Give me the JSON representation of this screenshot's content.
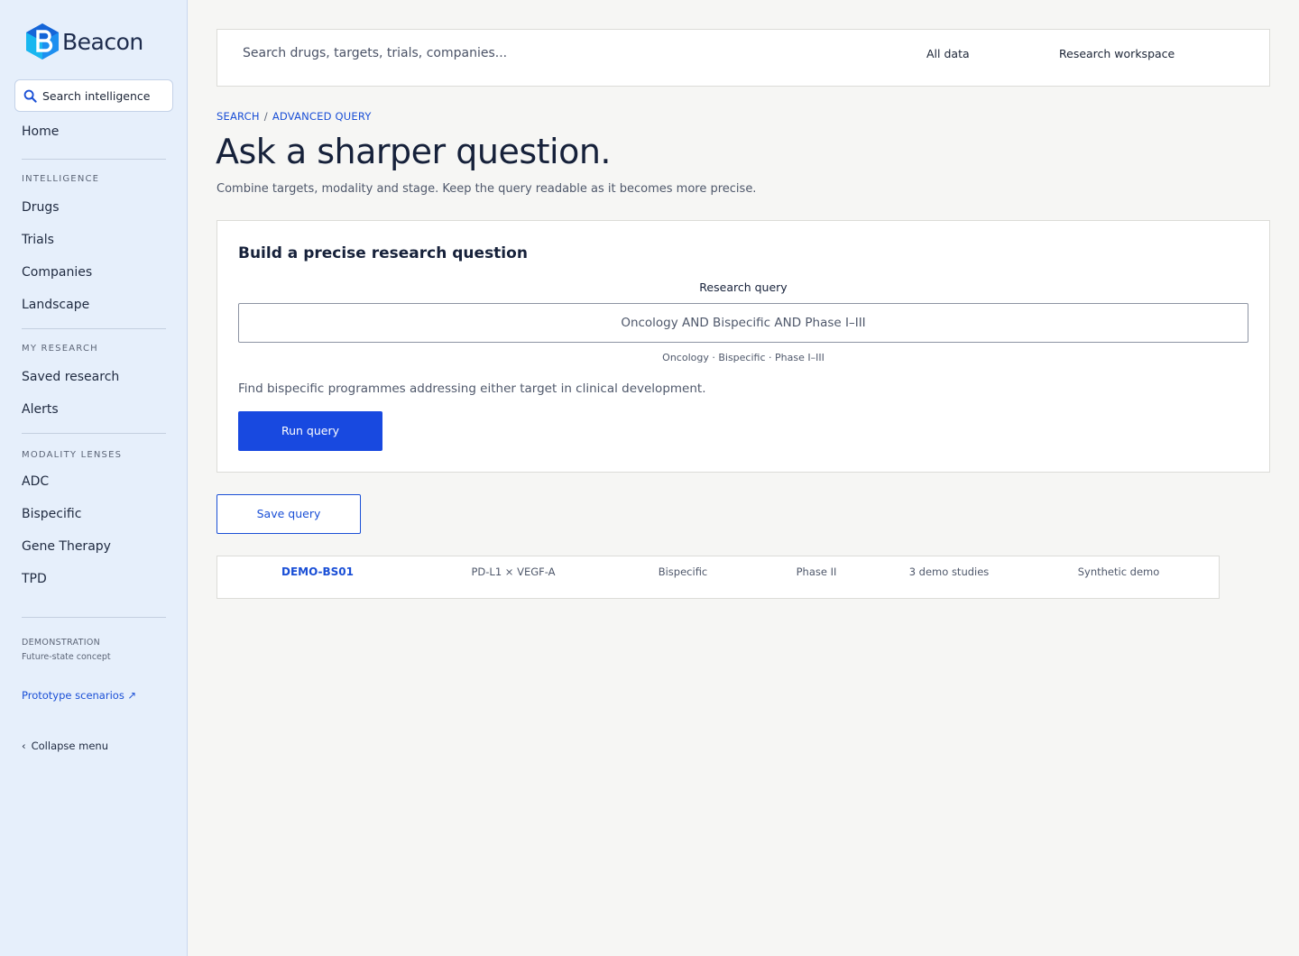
{
  "brand": {
    "name": "Beacon",
    "accent": "#1849e0"
  },
  "sidebar": {
    "search_label": "Search intelligence",
    "home": "Home",
    "sections": [
      {
        "title": "INTELLIGENCE",
        "items": [
          "Drugs",
          "Trials",
          "Companies",
          "Landscape"
        ]
      },
      {
        "title": "MY RESEARCH",
        "items": [
          "Saved research",
          "Alerts"
        ]
      },
      {
        "title": "MODALITY LENSES",
        "items": [
          "ADC",
          "Bispecific",
          "Gene Therapy",
          "TPD"
        ]
      }
    ],
    "demo_label": "DEMONSTRATION",
    "demo_sub": "Future-state concept",
    "prototype_link": "Prototype scenarios ↗",
    "collapse": "Collapse menu"
  },
  "topbar": {
    "search_placeholder": "Search drugs, targets, trials, companies...",
    "scope": "All data",
    "workspace": "Research workspace"
  },
  "breadcrumb": [
    "SEARCH",
    "ADVANCED QUERY"
  ],
  "page": {
    "title": "Ask a sharper question.",
    "subtitle": "Combine targets, modality and stage. Keep the query readable as it becomes more precise."
  },
  "query_card": {
    "title": "Build a precise research question",
    "label": "Research query",
    "value": "Oncology AND Bispecific AND Phase I–III",
    "chips": "Oncology · Bispecific · Phase I–III",
    "description": "Find bispecific programmes addressing either target in clinical development.",
    "run_label": "Run query"
  },
  "save_label": "Save query",
  "result_row": {
    "id": "DEMO-BS01",
    "targets": "PD-L1 × VEGF-A",
    "modality": "Bispecific",
    "phase": "Phase II",
    "studies": "3 demo studies",
    "source": "Synthetic demo"
  }
}
